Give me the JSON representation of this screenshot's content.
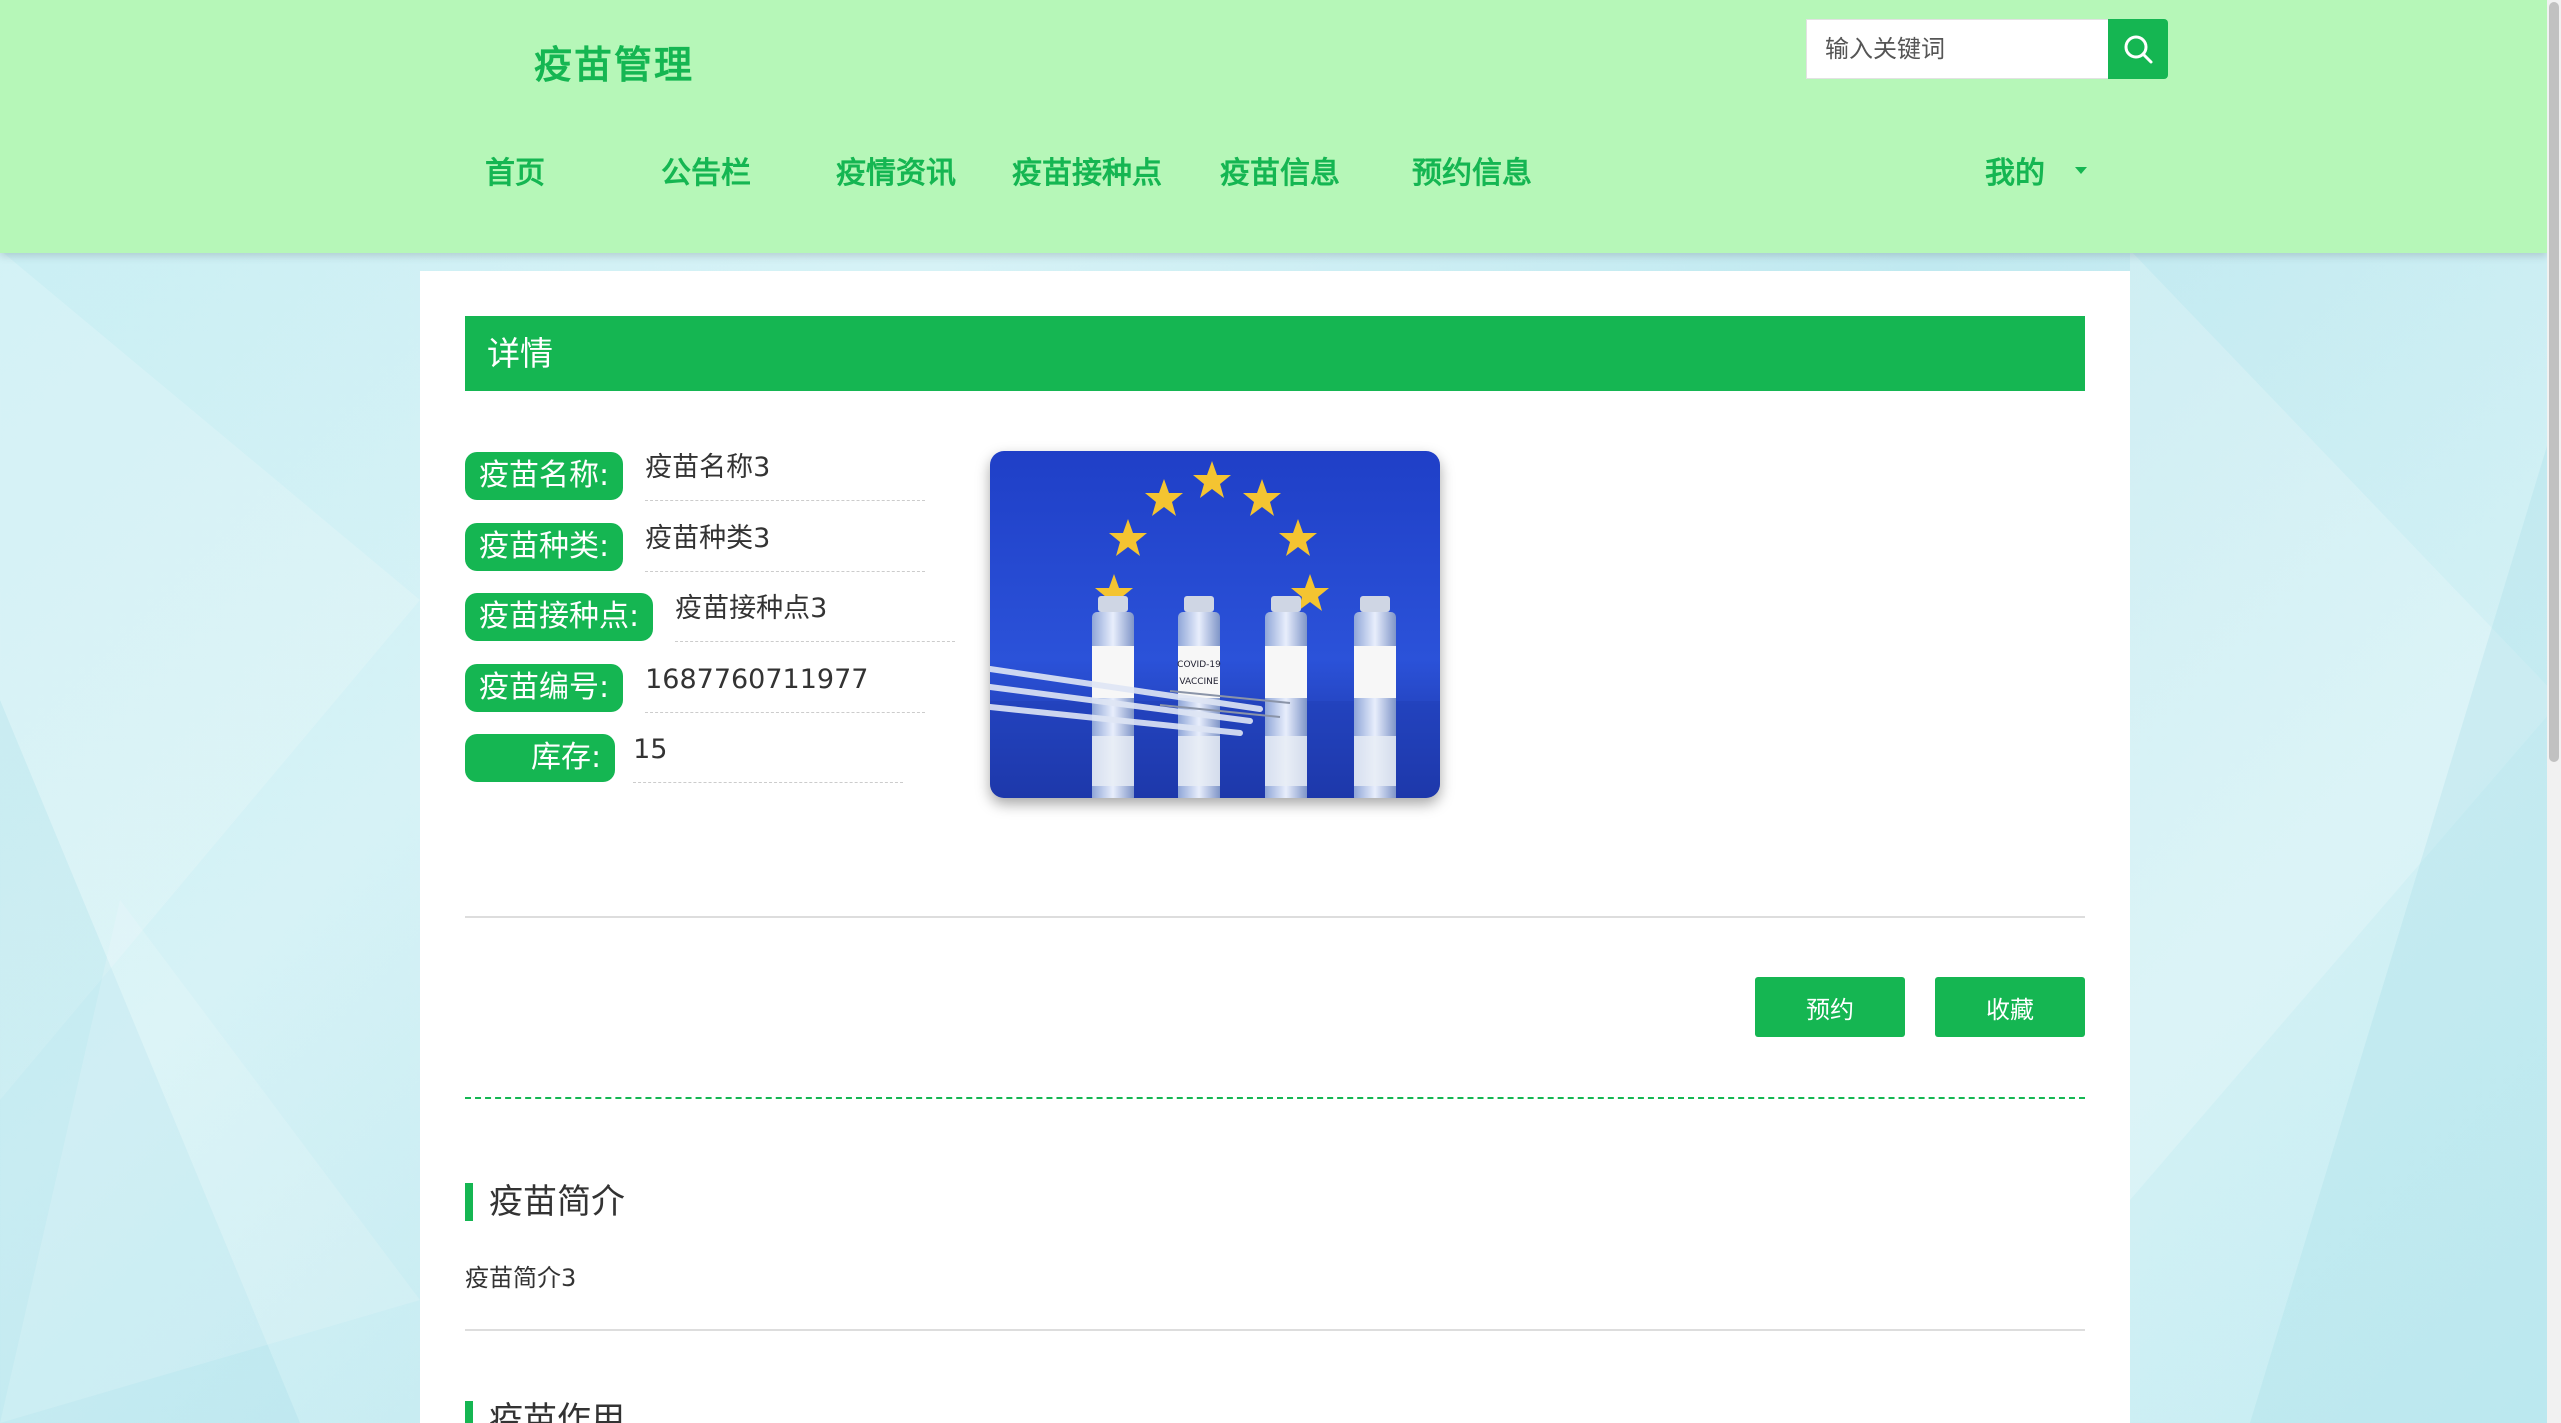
{
  "brand": {
    "title": "疫苗管理",
    "accent": "#15b652",
    "header_bg": "#b6f7b8"
  },
  "search": {
    "placeholder": "输入关键词",
    "icon": "search-icon"
  },
  "nav": {
    "items": [
      "首页",
      "公告栏",
      "疫情资讯",
      "疫苗接种点",
      "疫苗信息",
      "预约信息"
    ],
    "mine": "我的"
  },
  "detail": {
    "header": "详情",
    "fields": [
      {
        "label": "疫苗名称:",
        "value": "疫苗名称3"
      },
      {
        "label": "疫苗种类:",
        "value": "疫苗种类3"
      },
      {
        "label": "疫苗接种点:",
        "value": "疫苗接种点3"
      },
      {
        "label": "疫苗编号:",
        "value": "1687760711977"
      },
      {
        "label": "库存:",
        "value": "15"
      }
    ],
    "photo_alt": "vaccine-vials-image",
    "vial_label": "COVID-19",
    "vial_label_2": "VACCINE"
  },
  "actions": {
    "book": "预约",
    "favorite": "收藏"
  },
  "sections": [
    {
      "title": "疫苗简介",
      "text": "疫苗简介3"
    },
    {
      "title": "疫苗作用"
    }
  ]
}
